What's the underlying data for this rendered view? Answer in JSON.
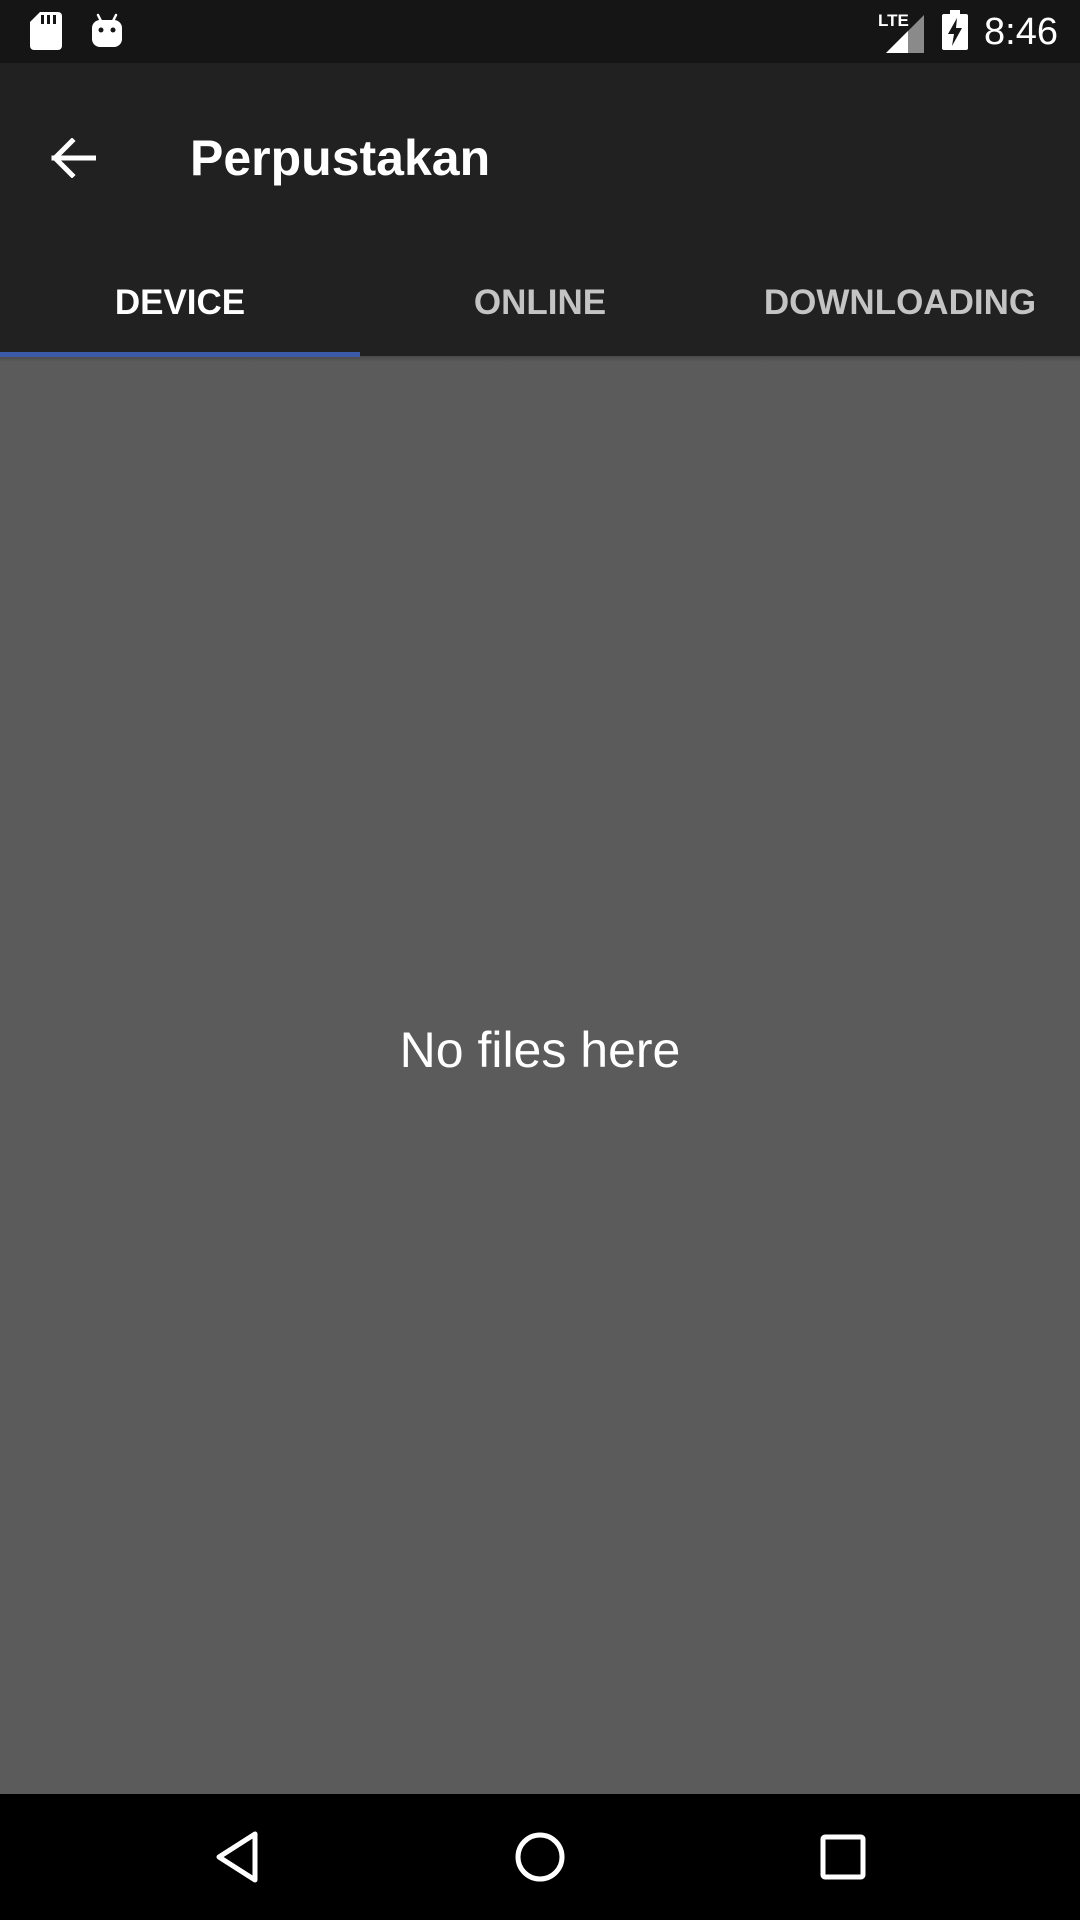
{
  "status_bar": {
    "time": "8:46",
    "network": "LTE",
    "left_icons": [
      "sd-card-icon",
      "android-icon"
    ],
    "right_icons": [
      "signal-icon",
      "battery-charging-icon"
    ]
  },
  "app_bar": {
    "title": "Perpustakan",
    "back_icon": "arrow-back-icon"
  },
  "tabs": [
    {
      "label": "DEVICE",
      "active": true
    },
    {
      "label": "ONLINE",
      "active": false
    },
    {
      "label": "DOWNLOADING",
      "active": false
    }
  ],
  "content": {
    "empty_message": "No files here"
  },
  "nav_bar": {
    "buttons": [
      "back-triangle-icon",
      "home-circle-icon",
      "recents-square-icon"
    ]
  },
  "colors": {
    "status_bar": "#151515",
    "app_bar": "#212121",
    "content_bg": "#5b5b5b",
    "tab_indicator": "#3c5aa8",
    "nav_bar": "#000000"
  }
}
